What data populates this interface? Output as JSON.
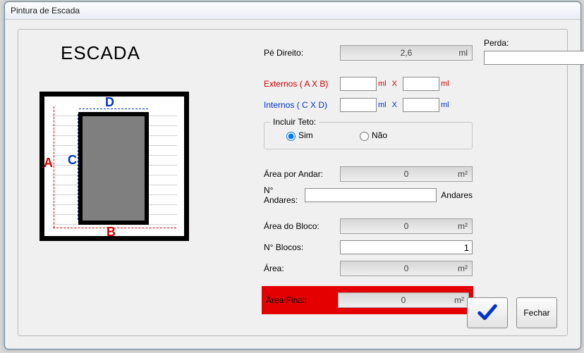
{
  "window": {
    "title": "Pintura de Escada"
  },
  "heading": "ESCADA",
  "diagram": {
    "A": "A",
    "B": "B",
    "C": "C",
    "D": "D"
  },
  "perda": {
    "label": "Perda:",
    "value": "",
    "unit": "%"
  },
  "fields": {
    "pe_direito": {
      "label": "Pé Direito:",
      "value": "2,6",
      "unit": "ml"
    },
    "externos": {
      "label": "Externos  ( A X B)",
      "v1": "",
      "u1": "ml",
      "sep": "X",
      "v2": "",
      "u2": "ml"
    },
    "internos": {
      "label": "Internos  ( C X D)",
      "v1": "",
      "u1": "ml",
      "sep": "X",
      "v2": "",
      "u2": "ml"
    },
    "teto": {
      "legend": "Incluir Teto:",
      "opt_sim": "Sim",
      "opt_nao": "Não",
      "selected": "sim"
    },
    "area_andar": {
      "label": "Área por Andar:",
      "value": "0",
      "unit": "m²"
    },
    "n_andares": {
      "label": "N° Andares:",
      "value": "",
      "unit": "Andares"
    },
    "area_bloco": {
      "label": "Área do Bloco:",
      "value": "0",
      "unit": "m²"
    },
    "n_blocos": {
      "label": "N° Blocos:",
      "value": "1",
      "unit": ""
    },
    "area": {
      "label": "Área:",
      "value": "0",
      "unit": "m²"
    },
    "area_final": {
      "label": "Área Final:",
      "value": "0",
      "unit": "m²"
    }
  },
  "buttons": {
    "ok": "OK",
    "close": "Fechar"
  }
}
